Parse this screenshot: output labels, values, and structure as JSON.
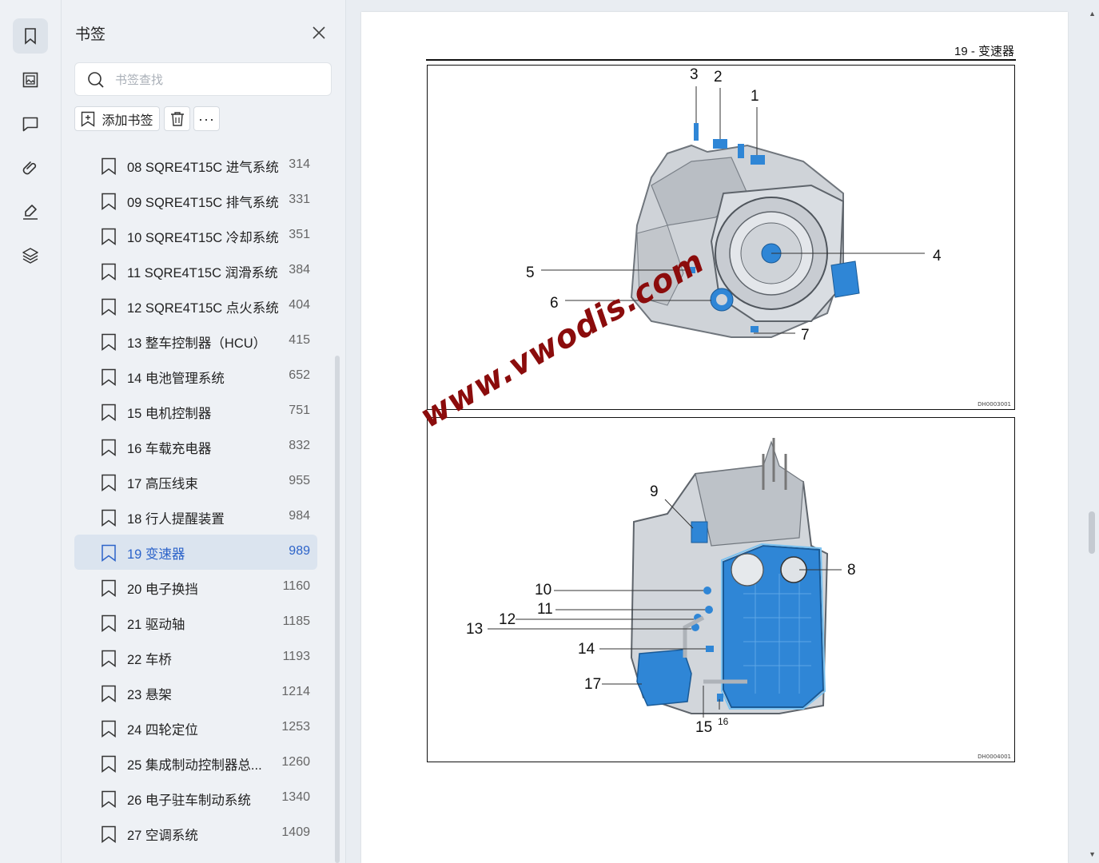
{
  "rail": {
    "items": [
      {
        "name": "bookmark-icon",
        "active": true
      },
      {
        "name": "thumbnail-icon",
        "active": false
      },
      {
        "name": "comment-icon",
        "active": false
      },
      {
        "name": "attachment-icon",
        "active": false
      },
      {
        "name": "signature-icon",
        "active": false
      },
      {
        "name": "layers-icon",
        "active": false
      }
    ]
  },
  "panel": {
    "title": "书签",
    "search_placeholder": "书签查找",
    "add_label": "添加书签",
    "more_label": "···",
    "items": [
      {
        "label": "08 SQRE4T15C 进气系统",
        "page": "314"
      },
      {
        "label": "09 SQRE4T15C 排气系统",
        "page": "331"
      },
      {
        "label": "10 SQRE4T15C 冷却系统",
        "page": "351"
      },
      {
        "label": "11 SQRE4T15C 润滑系统",
        "page": "384"
      },
      {
        "label": "12 SQRE4T15C 点火系统",
        "page": "404"
      },
      {
        "label": "13 整车控制器（HCU）",
        "page": "415"
      },
      {
        "label": "14 电池管理系统",
        "page": "652"
      },
      {
        "label": "15 电机控制器",
        "page": "751"
      },
      {
        "label": "16 车载充电器",
        "page": "832"
      },
      {
        "label": "17 高压线束",
        "page": "955"
      },
      {
        "label": "18 行人提醒装置",
        "page": "984"
      },
      {
        "label": "19 变速器",
        "page": "989",
        "active": true
      },
      {
        "label": "20 电子换挡",
        "page": "1160"
      },
      {
        "label": "21 驱动轴",
        "page": "1185"
      },
      {
        "label": "22 车桥",
        "page": "1193"
      },
      {
        "label": "23 悬架",
        "page": "1214"
      },
      {
        "label": "24 四轮定位",
        "page": "1253"
      },
      {
        "label": "25 集成制动控制器总...",
        "page": "1260"
      },
      {
        "label": "26 电子驻车制动系统",
        "page": "1340"
      },
      {
        "label": "27 空调系统",
        "page": "1409"
      }
    ]
  },
  "document": {
    "page_header": "19 - 变速器",
    "watermark": "www.vwodis.com",
    "figure1": {
      "code": "DH0003001",
      "callouts": {
        "c1": "1",
        "c2": "2",
        "c3": "3",
        "c4": "4",
        "c5": "5",
        "c6": "6",
        "c7": "7"
      }
    },
    "figure2": {
      "code": "DH0004001",
      "callouts": {
        "c8": "8",
        "c9": "9",
        "c10": "10",
        "c11": "11",
        "c12": "12",
        "c13": "13",
        "c14": "14",
        "c15": "15",
        "c16": "16",
        "c17": "17"
      }
    }
  },
  "colors": {
    "accent": "#2c63c9",
    "active_bg": "#dbe4ef",
    "part_blue": "#2f86d6",
    "watermark": "#8b0c0c"
  }
}
